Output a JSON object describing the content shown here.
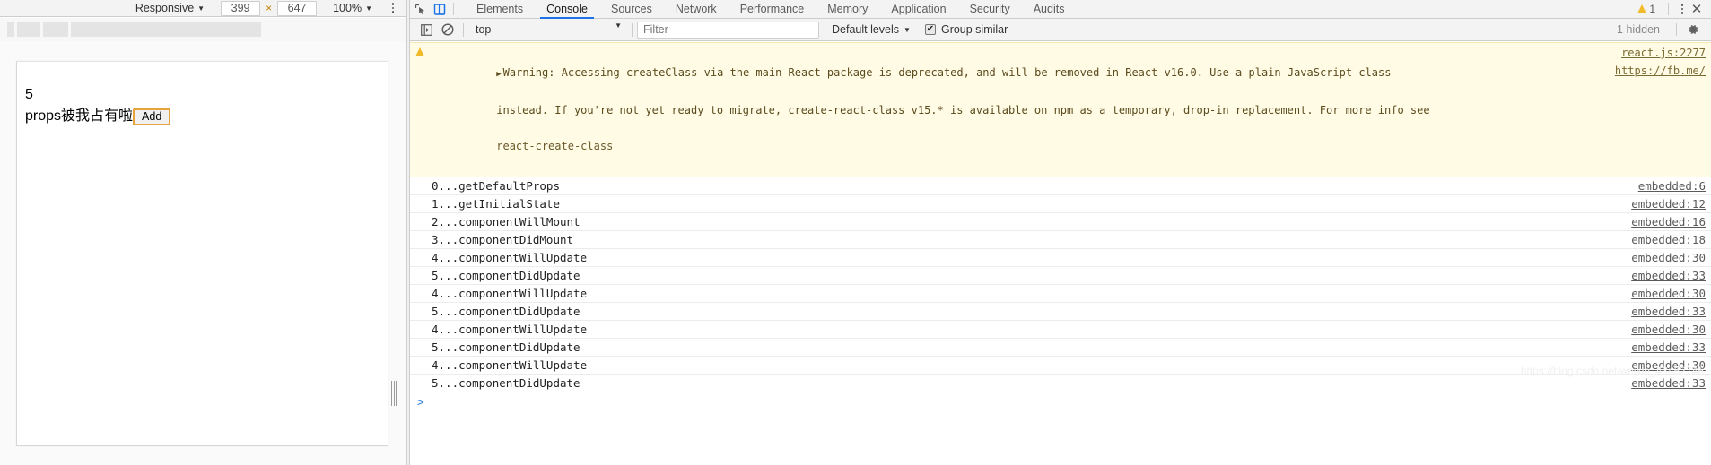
{
  "device_toolbar": {
    "device": "Responsive",
    "device_caret": "▼",
    "width": "399",
    "height": "647",
    "x_sep": "×",
    "zoom": "100%",
    "zoom_caret": "▼"
  },
  "page": {
    "counter": "5",
    "text": "props被我占有啦",
    "add_label": "Add"
  },
  "devtools": {
    "tabs": [
      {
        "label": "Elements",
        "active": false
      },
      {
        "label": "Console",
        "active": true
      },
      {
        "label": "Sources",
        "active": false
      },
      {
        "label": "Network",
        "active": false
      },
      {
        "label": "Performance",
        "active": false
      },
      {
        "label": "Memory",
        "active": false
      },
      {
        "label": "Application",
        "active": false
      },
      {
        "label": "Security",
        "active": false
      },
      {
        "label": "Audits",
        "active": false
      }
    ],
    "warning_count": "1",
    "close_glyph": "✕"
  },
  "console_toolbar": {
    "context": "top",
    "context_caret": "▼",
    "filter_placeholder": "Filter",
    "levels": "Default levels",
    "levels_caret": "▼",
    "group_similar": "Group similar",
    "group_similar_checked": true,
    "check_glyph": "✔",
    "hidden": "1 hidden"
  },
  "console": {
    "warning": {
      "disclosure": "▶",
      "line1": "Warning: Accessing createClass via the main React package is deprecated, and will be removed in React v16.0. Use a plain JavaScript class",
      "line2": "instead. If you're not yet ready to migrate, create-react-class v15.* is available on npm as a temporary, drop-in replacement. For more info see",
      "line3_link": "react-create-class",
      "source1": "react.js:2277",
      "source2": "https://fb.me/"
    },
    "rows": [
      {
        "text": "0...getDefaultProps",
        "source": "embedded:6"
      },
      {
        "text": "1...getInitialState",
        "source": "embedded:12"
      },
      {
        "text": "2...componentWillMount",
        "source": "embedded:16"
      },
      {
        "text": "3...componentDidMount",
        "source": "embedded:18"
      },
      {
        "text": "4...componentWillUpdate",
        "source": "embedded:30"
      },
      {
        "text": "5...componentDidUpdate",
        "source": "embedded:33"
      },
      {
        "text": "4...componentWillUpdate",
        "source": "embedded:30"
      },
      {
        "text": "5...componentDidUpdate",
        "source": "embedded:33"
      },
      {
        "text": "4...componentWillUpdate",
        "source": "embedded:30"
      },
      {
        "text": "5...componentDidUpdate",
        "source": "embedded:33"
      },
      {
        "text": "4...componentWillUpdate",
        "source": "embedded:30"
      },
      {
        "text": "5...componentDidUpdate",
        "source": "embedded:33"
      }
    ],
    "prompt": ">"
  },
  "watermark": "https://blog.csdn.net/weixin_43462746"
}
